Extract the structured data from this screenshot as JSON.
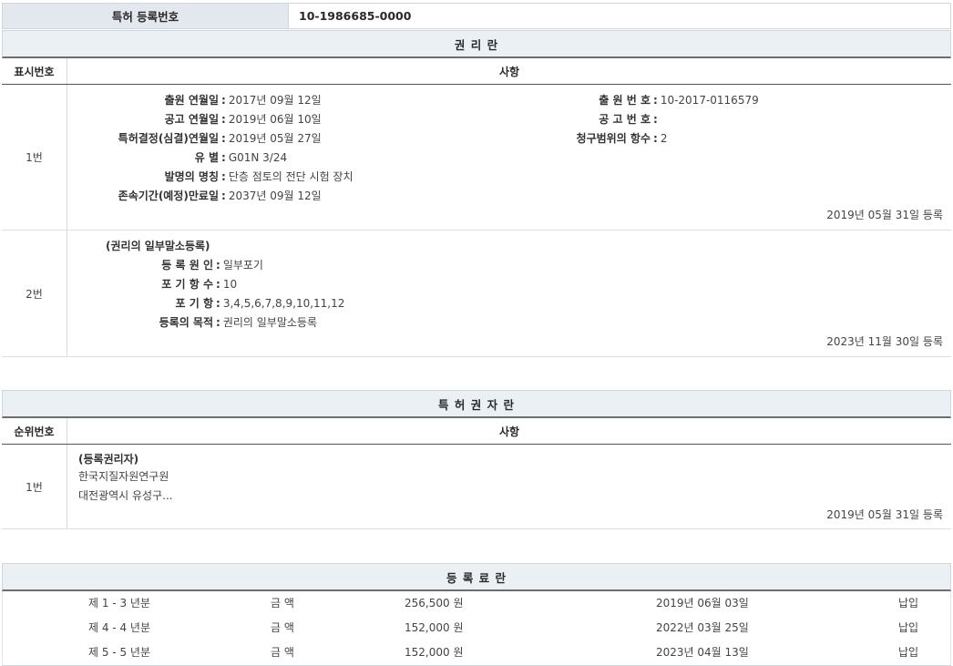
{
  "registration": {
    "label": "특허 등록번호",
    "value": "10-1986685-0000"
  },
  "rights": {
    "title": "권 리 란",
    "col_num": "표시번호",
    "col_main": "사항",
    "entry1": {
      "num": "1번",
      "left": [
        {
          "key": "출원 연월일",
          "value": "2017년 09월 12일"
        },
        {
          "key": "공고 연월일",
          "value": "2019년 06월 10일"
        },
        {
          "key": "특허결정(심결)연월일",
          "value": "2019년 05월 27일"
        },
        {
          "key": "유 별",
          "value": "G01N 3/24"
        },
        {
          "key": "발명의 명칭",
          "value": "단층 점토의 전단 시험 장치"
        },
        {
          "key": "존속기간(예정)만료일",
          "value": "2037년 09월 12일"
        }
      ],
      "right": [
        {
          "key": "출 원 번 호",
          "value": "10-2017-0116579"
        },
        {
          "key": "공 고 번 호",
          "value": ""
        },
        {
          "key": "청구범위의 항수",
          "value": "2"
        }
      ],
      "stamp": "2019년 05월 31일 등록"
    },
    "entry2": {
      "num": "2번",
      "heading": "(권리의 일부말소등록)",
      "items": [
        {
          "key": "등 록 원 인",
          "value": "일부포기"
        },
        {
          "key": "포 기 항 수",
          "value": "10"
        },
        {
          "key": "포 기 항",
          "value": "3,4,5,6,7,8,9,10,11,12"
        },
        {
          "key": "등록의 목적",
          "value": "권리의 일부말소등록"
        }
      ],
      "stamp": "2023년 11월 30일 등록"
    }
  },
  "holders": {
    "title": "특 허 권 자 란",
    "col_num": "순위번호",
    "col_main": "사항",
    "entry1": {
      "num": "1번",
      "heading": "(등록권리자)",
      "name": "한국지질자원연구원",
      "address": "대전광역시 유성구...",
      "stamp": "2019년 05월 31일 등록"
    }
  },
  "fees": {
    "title": "등 록 료 란",
    "rows": [
      {
        "period": "제 1 - 3 년분",
        "label": "금 액",
        "amount": "256,500 원",
        "date": "2019년 06월 03일",
        "status": "납입"
      },
      {
        "period": "제 4 - 4 년분",
        "label": "금 액",
        "amount": "152,000 원",
        "date": "2022년 03월 25일",
        "status": "납입"
      },
      {
        "period": "제 5 - 5 년분",
        "label": "금 액",
        "amount": "152,000 원",
        "date": "2023년 04월 13일",
        "status": "납입"
      }
    ]
  }
}
